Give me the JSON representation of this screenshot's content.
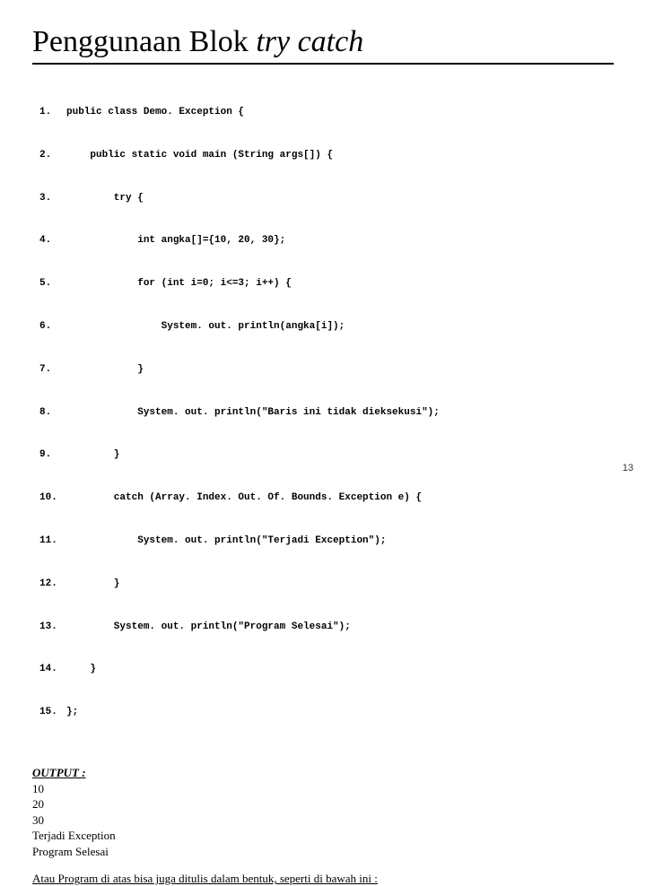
{
  "title": {
    "prefix": "Penggunaan Blok ",
    "italic": "try catch"
  },
  "code_lines": [
    "public class Demo. Exception {",
    "    public static void main (String args[]) {",
    "        try {",
    "            int angka[]={10, 20, 30};",
    "            for (int i=0; i<=3; i++) {",
    "                System. out. println(angka[i]);",
    "            }",
    "            System. out. println(\"Baris ini tidak dieksekusi\");",
    "        }",
    "        catch (Array. Index. Out. Of. Bounds. Exception e) {",
    "            System. out. println(\"Terjadi Exception\");",
    "        }",
    "        System. out. println(\"Program Selesai\");",
    "    }",
    "};"
  ],
  "output_heading": "OUTPUT  :",
  "output_lines": [
    "10",
    "20",
    "30",
    "Terjadi Exception",
    "Program Selesai"
  ],
  "footer_note": "Atau Program di atas bisa juga ditulis dalam bentuk, seperti di bawah ini :",
  "page_number": "13"
}
